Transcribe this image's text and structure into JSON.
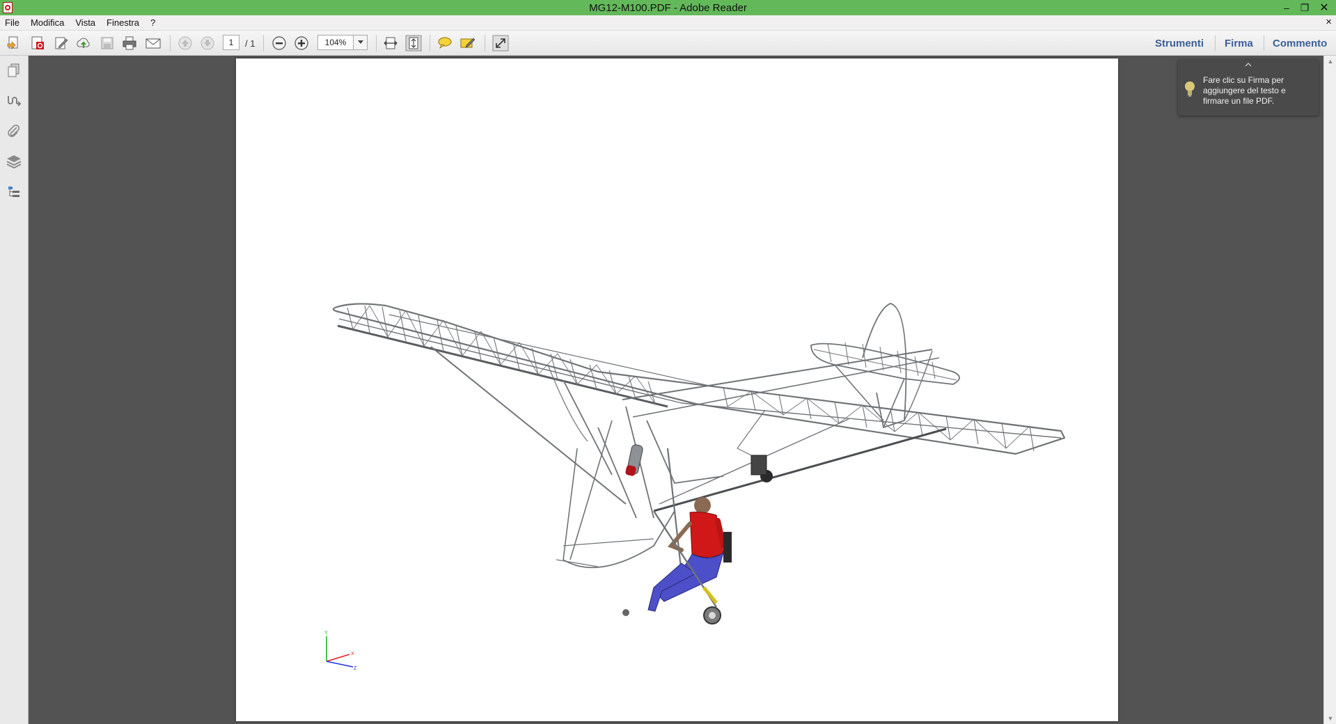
{
  "window": {
    "title": "MG12-M100.PDF - Adobe Reader",
    "minimize_glyph": "–",
    "restore_glyph": "❐",
    "close_glyph": "✕"
  },
  "menu": {
    "items": [
      "File",
      "Modifica",
      "Vista",
      "Finestra",
      "?"
    ],
    "close_doc_glyph": "×"
  },
  "toolbar": {
    "page_current": "1",
    "page_total": "/ 1",
    "zoom": "104%",
    "right_tabs": [
      "Strumenti",
      "Firma",
      "Commento"
    ],
    "icons": [
      "create-pdf-icon",
      "acrobat-icon",
      "edit-icon",
      "upload-icon",
      "save-icon",
      "print-icon",
      "email-icon",
      "prev-page-icon",
      "next-page-icon",
      "zoom-out-icon",
      "zoom-in-icon",
      "fit-width-icon",
      "fit-page-icon",
      "comment-icon",
      "highlight-icon",
      "fullscreen-icon"
    ]
  },
  "nav_panel": {
    "icons": [
      "page-thumbnails-icon",
      "signatures-icon",
      "attachments-icon",
      "layers-icon",
      "model-tree-icon"
    ]
  },
  "tooltip": {
    "text": "Fare clic su Firma per aggiungere del testo e firmare un file PDF."
  },
  "document": {
    "axis_labels": {
      "y": "Y",
      "x": "X",
      "z": "Z"
    },
    "colors": {
      "frame": "#6f7377",
      "pilot_shirt": "#d01818",
      "pilot_pants": "#4c4fc8",
      "engine_red": "#b3121a",
      "axis_x": "#e02020",
      "axis_y": "#20b020",
      "axis_z": "#2030e0"
    }
  }
}
